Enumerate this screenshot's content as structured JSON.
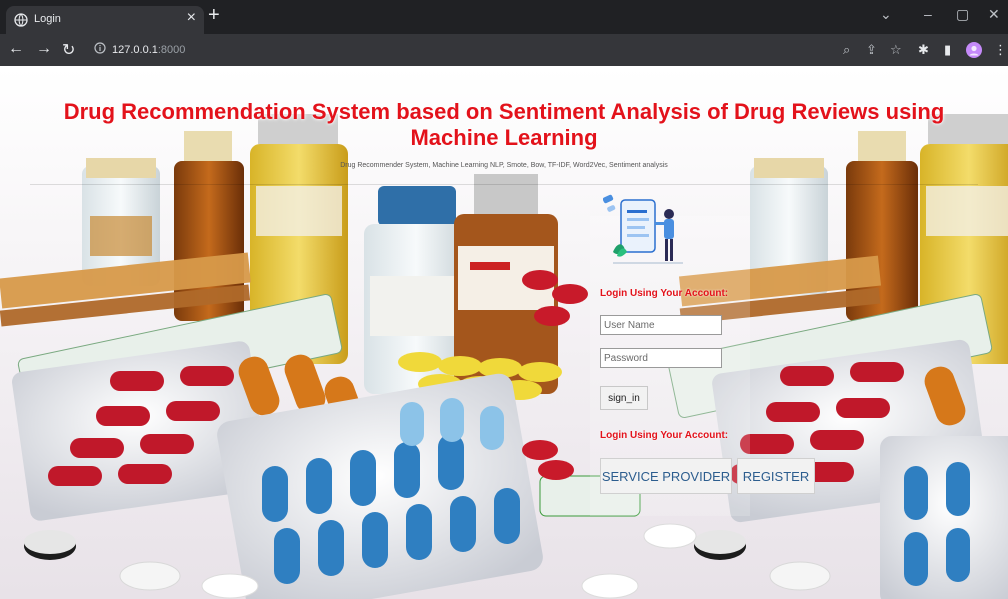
{
  "browser": {
    "tab_title": "Login",
    "tab_close": "×",
    "new_tab": "+",
    "url_host": "127.0.0.1",
    "url_port": ":8000",
    "controls": {
      "minimize": "–",
      "maximize": "▢",
      "close": "✕",
      "dropdown": "⌄"
    }
  },
  "page": {
    "heading": "Drug Recommendation System based on Sentiment Analysis of Drug Reviews using Machine Learning",
    "subtitle": "Drug Recommender System, Machine Learning NLP, Smote, Bow, TF-IDF, Word2Vec, Sentiment analysis",
    "login_label": "Login Using Your Account:",
    "username_placeholder": "User Name",
    "password_placeholder": "Password",
    "signin_label": "sign_in",
    "login_label2": "Login Using Your Account:",
    "service_provider_label": "SERVICE PROVIDER",
    "register_label": "REGISTER"
  },
  "colors": {
    "heading_red": "#e3121b",
    "link_blue": "#2c5d8e",
    "chrome_dark": "#202124",
    "chrome_bar": "#35363a"
  }
}
